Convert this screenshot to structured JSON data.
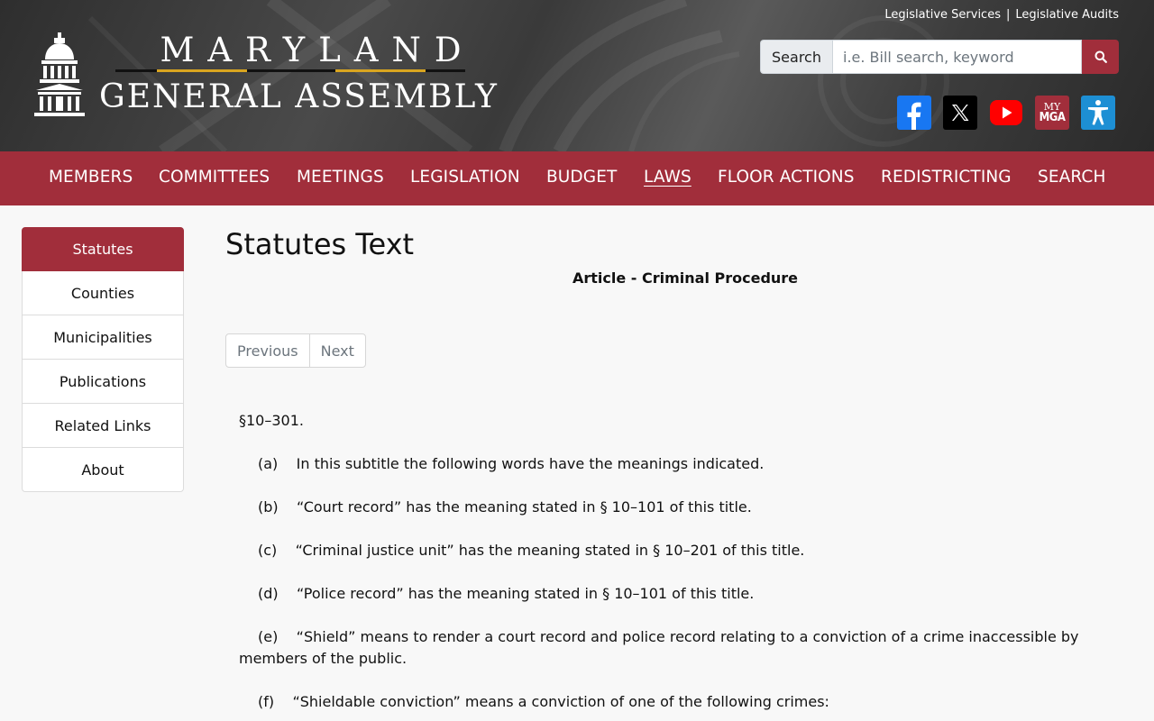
{
  "header": {
    "logo_top": "MARYLAND",
    "logo_bottom": "GENERAL ASSEMBLY",
    "util_links": [
      "Legislative Services",
      "Legislative Audits"
    ],
    "util_sep": "|",
    "search_label": "Search",
    "search_placeholder": "i.e. Bill search, keyword",
    "social": {
      "mga_line1": "MY",
      "mga_line2": "MGA"
    },
    "icons": [
      "capitol-dome-icon",
      "search-icon",
      "facebook-icon",
      "x-twitter-icon",
      "youtube-icon",
      "my-mga-icon",
      "accessibility-icon"
    ]
  },
  "nav": {
    "items": [
      "MEMBERS",
      "COMMITTEES",
      "MEETINGS",
      "LEGISLATION",
      "BUDGET",
      "LAWS",
      "FLOOR ACTIONS",
      "REDISTRICTING",
      "SEARCH"
    ],
    "active": "LAWS"
  },
  "sidebar": {
    "items": [
      "Statutes",
      "Counties",
      "Municipalities",
      "Publications",
      "Related Links",
      "About"
    ],
    "active": "Statutes"
  },
  "main": {
    "title": "Statutes Text",
    "article": "Article - Criminal Procedure",
    "pager": {
      "previous": "Previous",
      "next": "Next"
    },
    "section": "§10–301.",
    "paragraphs": [
      "(a)    In this subtitle the following words have the meanings indicated.",
      "(b)    “Court record” has the meaning stated in § 10–101 of this title.",
      "(c)    “Criminal justice unit” has the meaning stated in § 10–201 of this title.",
      "(d)    “Police record” has the meaning stated in § 10–101 of this title.",
      "(e)    “Shield” means to render a court record and police record relating to a conviction of a crime inaccessible by members of the public.",
      "(f)    “Shieldable conviction” means a conviction of one of the following crimes:"
    ]
  },
  "colors": {
    "brand": "#a12e3b",
    "gold": "#d9a520",
    "facebook": "#1877f2",
    "youtube": "#ff0000",
    "accessibility": "#1d8fd4"
  }
}
